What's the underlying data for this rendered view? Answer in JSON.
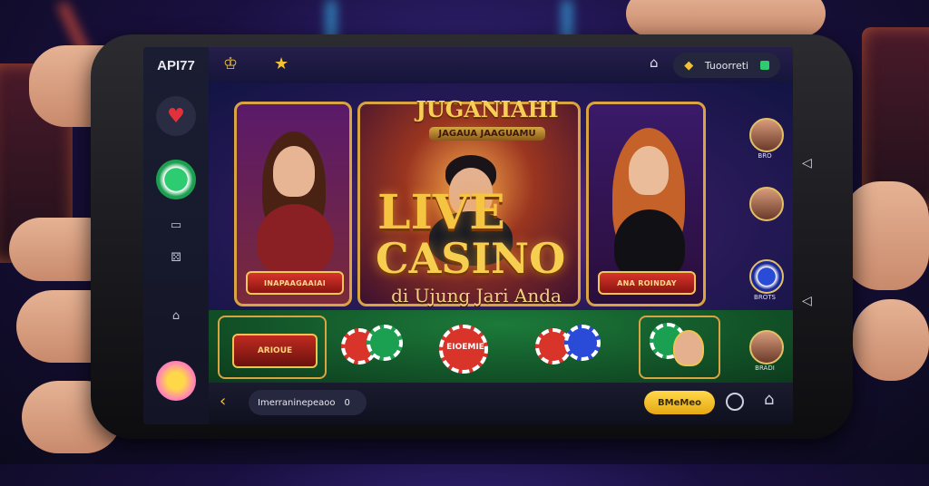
{
  "app": {
    "brand": "API77"
  },
  "topbar": {
    "pill_text": "Tuoorreti",
    "status_color": "#2ecc71",
    "icons": [
      "crown-icon",
      "star-icon",
      "gift-icon",
      "chat-icon"
    ]
  },
  "left_rail": {
    "items": [
      {
        "name": "heart-icon",
        "label": "♥"
      },
      {
        "name": "chip-icon",
        "label": "●"
      },
      {
        "name": "card-icon",
        "label": "▭"
      },
      {
        "name": "dice-icon",
        "label": "⚄"
      },
      {
        "name": "home-icon",
        "label": "⌂"
      },
      {
        "name": "profile-icon",
        "label": "●"
      }
    ]
  },
  "stage": {
    "title": "JUGANIAHI",
    "subtitle": "JAGAUA JAAGUAMU",
    "big_line1": "LIVE",
    "big_line2": "CASINO",
    "tagline": "di Ujung Jari Anda",
    "left_banner": "INAPAAGAAIAI",
    "right_banner": "ANA ROINDAY"
  },
  "table": {
    "badge_text": "ARIOUE",
    "chip_label": "EIOEMIE"
  },
  "bottombar": {
    "search_text": "Imerraninepeaoo",
    "search_count": "0",
    "button_label": "BMeMeo"
  },
  "right_rail": {
    "avatar_labels": [
      "BRO",
      "",
      "BROTS",
      "BRADI"
    ],
    "nav": [
      "◁",
      "◁"
    ]
  },
  "colors": {
    "accent_gold": "#f5c542",
    "felt_green": "#1c7a3a",
    "brand_red": "#d8342a"
  }
}
